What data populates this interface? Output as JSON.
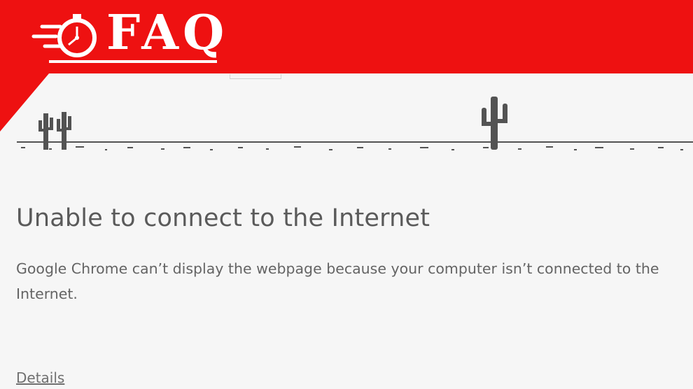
{
  "logo": {
    "text": "FAQ",
    "icon": "stopwatch-icon"
  },
  "scene": {
    "obstacles": [
      "cactus-icon",
      "cactus-icon",
      "cactus-icon"
    ]
  },
  "error": {
    "title": "Unable to connect to the Internet",
    "description_line1": "Google Chrome can’t display the webpage because your computer isn’t connected to the",
    "description_line2": "Internet.",
    "details_link": "Details"
  },
  "colors": {
    "banner_red": "#ee1111",
    "background": "#f6f6f6",
    "text": "#5a5a5a",
    "ground": "#535353"
  }
}
